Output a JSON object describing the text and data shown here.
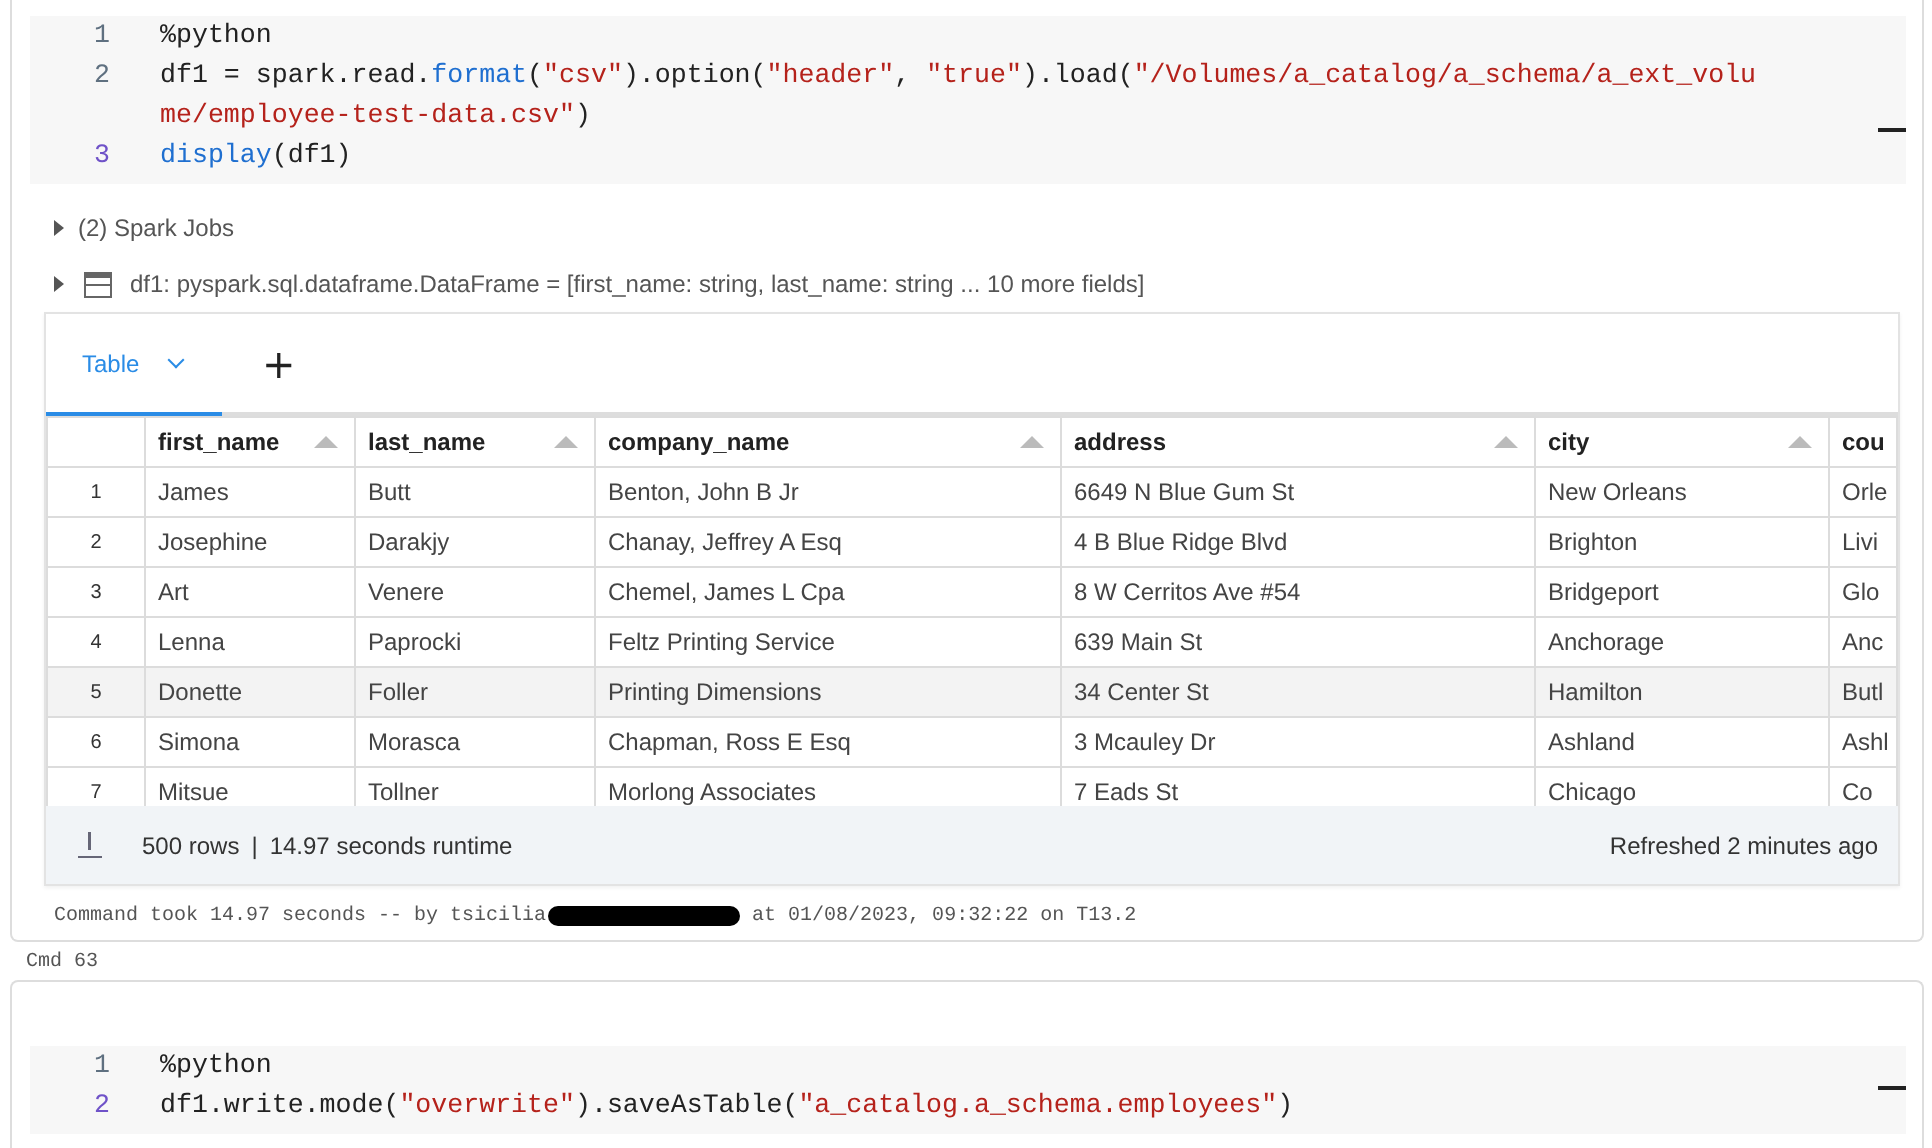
{
  "cells": [
    {
      "code_lines": [
        {
          "number": "1",
          "active": false,
          "tokens": [
            {
              "kind": "plain",
              "text": "%python"
            }
          ]
        },
        {
          "number": "2",
          "active": false,
          "tokens": [
            {
              "kind": "plain",
              "text": "df1 = spark.read."
            },
            {
              "kind": "func",
              "text": "format"
            },
            {
              "kind": "plain",
              "text": "("
            },
            {
              "kind": "string",
              "text": "\"csv\""
            },
            {
              "kind": "plain",
              "text": ").option("
            },
            {
              "kind": "string",
              "text": "\"header\""
            },
            {
              "kind": "plain",
              "text": ", "
            },
            {
              "kind": "string",
              "text": "\"true\""
            },
            {
              "kind": "plain",
              "text": ").load("
            },
            {
              "kind": "string",
              "text": "\"/Volumes/a_catalog/a_schema/a_ext_volume/employee-test-data.csv\""
            },
            {
              "kind": "plain",
              "text": ")"
            }
          ]
        },
        {
          "number": "3",
          "active": true,
          "tokens": [
            {
              "kind": "func",
              "text": "display"
            },
            {
              "kind": "plain",
              "text": "(df1)"
            }
          ]
        }
      ],
      "spark_jobs": {
        "label": "(2) Spark Jobs",
        "expanded": false
      },
      "dataframe": {
        "label": "df1:  pyspark.sql.dataframe.DataFrame = [first_name: string, last_name: string ... 10 more fields]",
        "expanded": false
      },
      "results": {
        "tabs": [
          {
            "label": "Table",
            "selected": true
          }
        ],
        "add_label": "+",
        "table": {
          "columns": [
            {
              "label": "first_name",
              "sortable": true
            },
            {
              "label": "last_name",
              "sortable": true
            },
            {
              "label": "company_name",
              "sortable": true
            },
            {
              "label": "address",
              "sortable": true
            },
            {
              "label": "city",
              "sortable": true
            },
            {
              "label": "cou",
              "sortable": false
            }
          ],
          "rows": [
            {
              "index": "1",
              "highlighted": false,
              "cells": [
                "James",
                "Butt",
                "Benton, John B Jr",
                "6649 N Blue Gum St",
                "New Orleans",
                "Orle"
              ]
            },
            {
              "index": "2",
              "highlighted": false,
              "cells": [
                "Josephine",
                "Darakjy",
                "Chanay, Jeffrey A Esq",
                "4 B Blue Ridge Blvd",
                "Brighton",
                "Livi"
              ]
            },
            {
              "index": "3",
              "highlighted": false,
              "cells": [
                "Art",
                "Venere",
                "Chemel, James L Cpa",
                "8 W Cerritos Ave #54",
                "Bridgeport",
                "Glo"
              ]
            },
            {
              "index": "4",
              "highlighted": false,
              "cells": [
                "Lenna",
                "Paprocki",
                "Feltz Printing Service",
                "639 Main St",
                "Anchorage",
                "Anc"
              ]
            },
            {
              "index": "5",
              "highlighted": true,
              "cells": [
                "Donette",
                "Foller",
                "Printing Dimensions",
                "34 Center St",
                "Hamilton",
                "Butl"
              ]
            },
            {
              "index": "6",
              "highlighted": false,
              "cells": [
                "Simona",
                "Morasca",
                "Chapman, Ross E Esq",
                "3 Mcauley Dr",
                "Ashland",
                "Ashl"
              ]
            },
            {
              "index": "7",
              "highlighted": false,
              "cells": [
                "Mitsue",
                "Tollner",
                "Morlong Associates",
                "7 Eads St",
                "Chicago",
                "Co"
              ]
            }
          ]
        },
        "footer": {
          "rows": "500 rows",
          "separator": "|",
          "runtime": "14.97 seconds runtime",
          "refreshed": "Refreshed 2 minutes ago"
        }
      },
      "command_info": {
        "before": "Command took 14.97 seconds -- by tsicilia",
        "redacted": true,
        "after": "at 01/08/2023, 09:32:22 on T13.2"
      }
    },
    {
      "label": "Cmd 63",
      "code_lines": [
        {
          "number": "1",
          "active": false,
          "tokens": [
            {
              "kind": "plain",
              "text": "%python"
            }
          ]
        },
        {
          "number": "2",
          "active": true,
          "tokens": [
            {
              "kind": "plain",
              "text": "df1.write.mode("
            },
            {
              "kind": "string",
              "text": "\"overwrite\""
            },
            {
              "kind": "plain",
              "text": ").saveAsTable("
            },
            {
              "kind": "string",
              "text": "\"a_catalog.a_schema.employees\""
            },
            {
              "kind": "plain",
              "text": ")"
            }
          ]
        }
      ]
    }
  ]
}
